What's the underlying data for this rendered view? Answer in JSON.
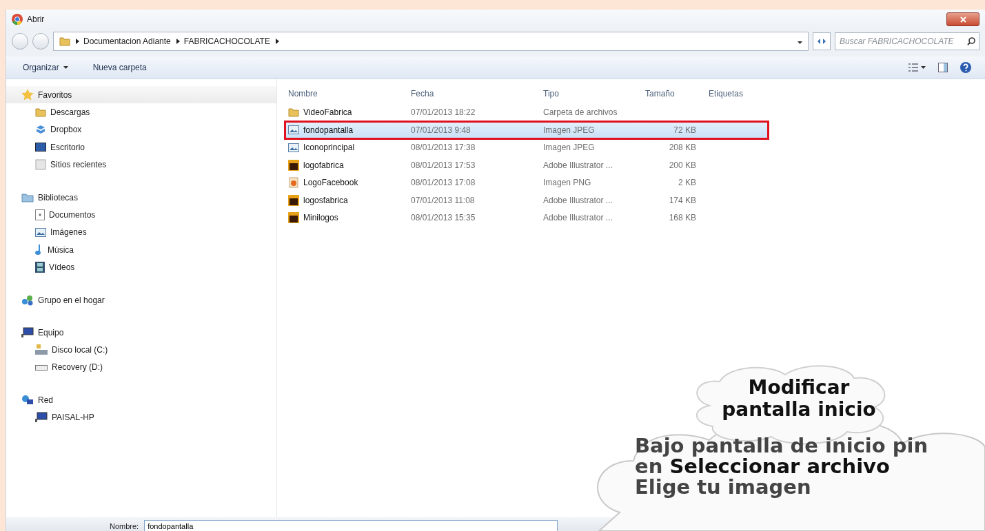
{
  "window": {
    "title": "Abrir"
  },
  "address": {
    "crumbs": [
      "Documentacion Adiante",
      "FABRICACHOCOLATE"
    ]
  },
  "search": {
    "placeholder": "Buscar FABRICACHOCOLATE"
  },
  "toolbar": {
    "buttons": [
      {
        "label": "Organizar",
        "dropdown": true
      },
      {
        "label": "Nueva carpeta",
        "dropdown": false
      }
    ]
  },
  "sidebar": {
    "groups": [
      {
        "label": "Favoritos",
        "selected": true,
        "items": [
          "Descargas",
          "Dropbox",
          "Escritorio",
          "Sitios recientes"
        ]
      },
      {
        "label": "Bibliotecas",
        "selected": false,
        "items": [
          "Documentos",
          "Imágenes",
          "Música",
          "Vídeos"
        ]
      },
      {
        "label": "Grupo en el hogar",
        "selected": false
      },
      {
        "label": "Equipo",
        "selected": false,
        "items": [
          "Disco local (C:)",
          "Recovery (D:)"
        ]
      },
      {
        "label": "Red",
        "selected": false,
        "items": [
          "PAISAL-HP"
        ]
      }
    ]
  },
  "table": {
    "columns": [
      "Nombre",
      "Fecha",
      "Tipo",
      "Tamaño",
      "Etiquetas"
    ],
    "rows": [
      {
        "kind": "folder",
        "name": "VideoFabrica",
        "date": "07/01/2013 18:22",
        "type": "Carpeta de archivos",
        "size": "",
        "selected": false,
        "outlined": false
      },
      {
        "kind": "image",
        "name": "fondopantalla",
        "date": "07/01/2013 9:48",
        "type": "Imagen JPEG",
        "size": "72 KB",
        "selected": true,
        "outlined": true
      },
      {
        "kind": "image",
        "name": "Iconoprincipal",
        "date": "08/01/2013 17:38",
        "type": "Imagen JPEG",
        "size": "208 KB",
        "selected": false,
        "outlined": false
      },
      {
        "kind": "illustrator",
        "name": "logofabrica",
        "date": "08/01/2013 17:53",
        "type": "Adobe Illustrator ...",
        "size": "200 KB",
        "selected": false,
        "outlined": false
      },
      {
        "kind": "png",
        "name": "LogoFacebook",
        "date": "08/01/2013 17:08",
        "type": "Imagen PNG",
        "size": "2 KB",
        "selected": false,
        "outlined": false
      },
      {
        "kind": "illustrator",
        "name": "logosfabrica",
        "date": "07/01/2013 11:08",
        "type": "Adobe Illustrator ...",
        "size": "174 KB",
        "selected": false,
        "outlined": false
      },
      {
        "kind": "illustrator",
        "name": "Minilogos",
        "date": "08/01/2013 15:35",
        "type": "Adobe Illustrator ...",
        "size": "168 KB",
        "selected": false,
        "outlined": false
      }
    ]
  },
  "filename": {
    "label": "Nombre:",
    "value": "fondopantalla"
  },
  "callout": {
    "title": "Modificar pantalla inicio",
    "lines": [
      "Bajo pantalla de inicio pin",
      "en **Seleccionar archivo**",
      "Elige tu imagen"
    ]
  }
}
